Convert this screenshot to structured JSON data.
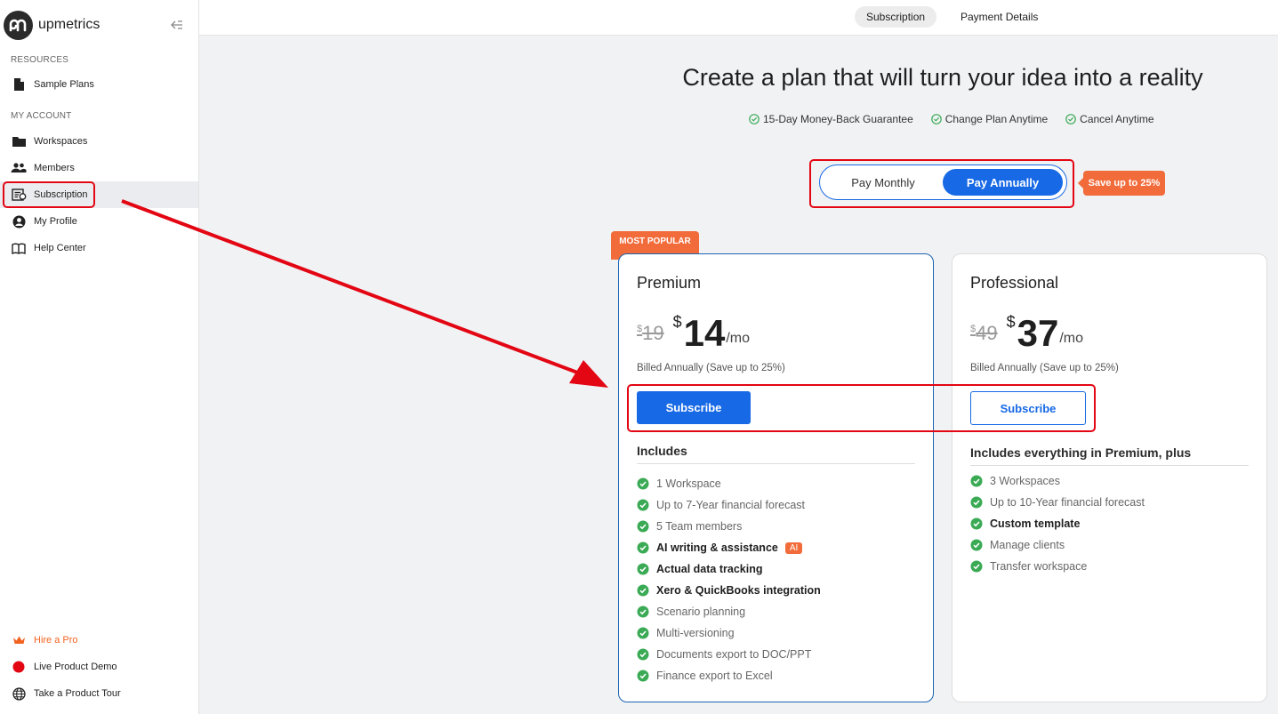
{
  "brand": {
    "name": "upmetrics"
  },
  "sidebar": {
    "resources_label": "RESOURCES",
    "account_label": "MY ACCOUNT",
    "resources": [
      {
        "label": "Sample Plans",
        "icon": "document-icon"
      }
    ],
    "account": [
      {
        "label": "Workspaces",
        "icon": "folder-icon"
      },
      {
        "label": "Members",
        "icon": "people-icon"
      },
      {
        "label": "Subscription",
        "icon": "subscription-icon"
      },
      {
        "label": "My Profile",
        "icon": "user-icon"
      },
      {
        "label": "Help Center",
        "icon": "book-icon"
      }
    ],
    "bottom": [
      {
        "label": "Hire a Pro",
        "icon": "crown-icon"
      },
      {
        "label": "Live Product Demo",
        "icon": "live-dot-icon"
      },
      {
        "label": "Take a Product Tour",
        "icon": "globe-icon"
      }
    ]
  },
  "tabs": [
    {
      "label": "Subscription"
    },
    {
      "label": "Payment Details"
    }
  ],
  "hero": {
    "headline": "Create a plan that will turn your idea into a reality",
    "guarantees": [
      "15-Day Money-Back Guarantee",
      "Change Plan Anytime",
      "Cancel Anytime"
    ]
  },
  "billing_toggle": {
    "monthly": "Pay Monthly",
    "annually": "Pay Annually",
    "save_badge": "Save up to 25%"
  },
  "plans": {
    "premium": {
      "tag": "MOST POPULAR",
      "name": "Premium",
      "currency": "$",
      "old_price": "19",
      "price": "14",
      "per": "/mo",
      "billed": "Billed Annually (Save up to 25%)",
      "cta": "Subscribe",
      "includes_title": "Includes",
      "features": [
        {
          "text": "1 Workspace"
        },
        {
          "text": "Up to 7-Year financial forecast"
        },
        {
          "text": "5 Team members"
        },
        {
          "text": "AI writing & assistance",
          "badge": "AI"
        },
        {
          "text": "Actual data tracking"
        },
        {
          "text": "Xero & QuickBooks integration"
        },
        {
          "text": "Scenario planning"
        },
        {
          "text": "Multi-versioning"
        },
        {
          "text": "Documents export to DOC/PPT"
        },
        {
          "text": "Finance export to Excel"
        }
      ]
    },
    "professional": {
      "name": "Professional",
      "currency": "$",
      "old_price": "49",
      "price": "37",
      "per": "/mo",
      "billed": "Billed Annually (Save up to 25%)",
      "cta": "Subscribe",
      "includes_title": "Includes everything in Premium, plus",
      "features": [
        {
          "text": "3 Workspaces"
        },
        {
          "text": "Up to 10-Year financial forecast"
        },
        {
          "text": "Custom template"
        },
        {
          "text": "Manage clients"
        },
        {
          "text": "Transfer workspace"
        }
      ]
    }
  },
  "colors": {
    "primary": "#1769e5",
    "accent": "#f26b3a",
    "check": "#3aaa55",
    "annotation": "#e30613"
  }
}
